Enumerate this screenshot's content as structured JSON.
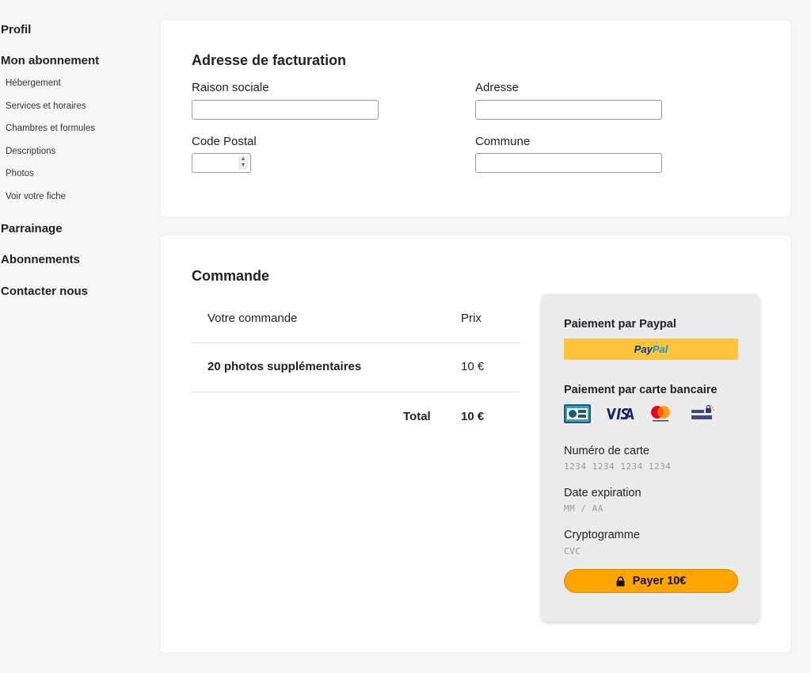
{
  "sidebar": {
    "main_items": [
      {
        "label": "Profil"
      },
      {
        "label": "Mon abonnement"
      },
      {
        "label": "Parrainage"
      },
      {
        "label": "Abonnements"
      },
      {
        "label": "Contacter nous"
      }
    ],
    "sub_items": [
      {
        "label": "Hébergement"
      },
      {
        "label": "Services et horaires"
      },
      {
        "label": "Chambres et formules"
      },
      {
        "label": "Descriptions"
      },
      {
        "label": "Photos"
      },
      {
        "label": "Voir votre fiche"
      }
    ]
  },
  "billing": {
    "title": "Adresse de facturation",
    "company_label": "Raison sociale",
    "company_value": "",
    "address_label": "Adresse",
    "address_value": "",
    "postal_label": "Code Postal",
    "postal_value": "",
    "city_label": "Commune",
    "city_value": ""
  },
  "order": {
    "title": "Commande",
    "col_item": "Votre commande",
    "col_price": "Prix",
    "items": [
      {
        "name": "20 photos supplémentaires",
        "price": "10 €"
      }
    ],
    "total_label": "Total",
    "total_value": "10 €"
  },
  "payment": {
    "paypal_heading": "Paiement par Paypal",
    "paypal_logo_part1": "Pay",
    "paypal_logo_part2": "Pal",
    "card_heading": "Paiement par carte bancaire",
    "card_logos": [
      "cb-icon",
      "visa-icon",
      "mastercard-icon",
      "letsencrypt-icon"
    ],
    "card_number_label": "Numéro de carte",
    "card_number_placeholder": "1234 1234 1234 1234",
    "expiry_label": "Date expiration",
    "expiry_placeholder": "MM / AA",
    "cvc_label": "Cryptogramme",
    "cvc_placeholder": "CVC",
    "pay_button_label": "Payer 10€"
  },
  "colors": {
    "paypal_yellow": "#ffc439",
    "pay_orange": "#ffa500",
    "visa_blue": "#1a1f71",
    "cb_blue": "#1d5a7a"
  }
}
